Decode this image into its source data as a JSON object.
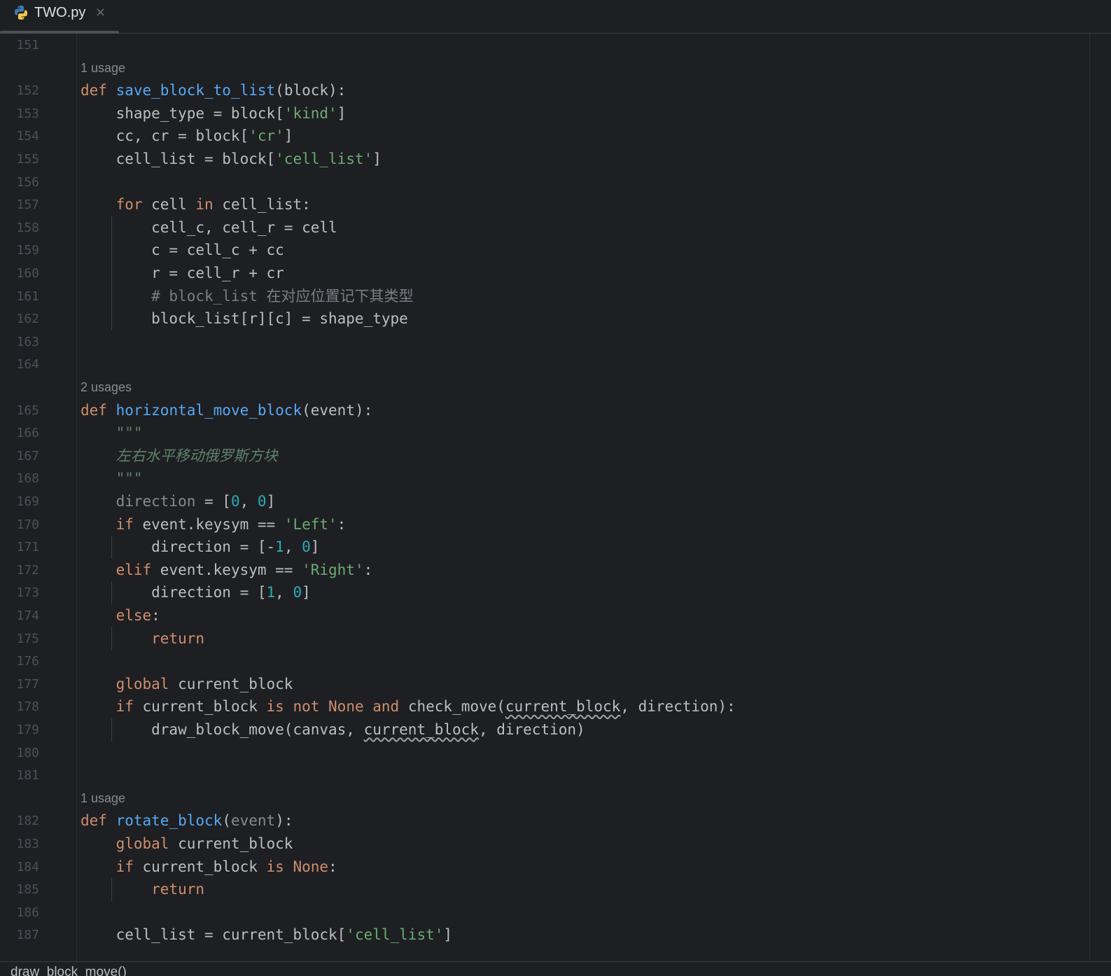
{
  "tab": {
    "file_name": "TWO.py",
    "close_glyph": "×",
    "icon": "python-file-icon"
  },
  "breadcrumb": "draw_block_move()",
  "colors": {
    "keyword": "#cf8e6d",
    "function": "#56a8f5",
    "string": "#6aab73",
    "number": "#2aacb8",
    "comment": "#7a7e85",
    "docstring": "#5f826b",
    "text": "#bcbec4"
  },
  "editor": {
    "lines": [
      {
        "num": "151",
        "tokens": []
      },
      {
        "hint": "1 usage"
      },
      {
        "num": "152",
        "tokens": [
          [
            "def",
            "kw"
          ],
          [
            " ",
            ""
          ],
          [
            "save_block_to_list",
            "fn"
          ],
          [
            "(block):",
            ""
          ]
        ]
      },
      {
        "num": "153",
        "tokens": [
          [
            "    shape_type = block[",
            ""
          ],
          [
            "'kind'",
            "str"
          ],
          [
            "]",
            ""
          ]
        ]
      },
      {
        "num": "154",
        "tokens": [
          [
            "    cc, cr = block[",
            ""
          ],
          [
            "'cr'",
            "str"
          ],
          [
            "]",
            ""
          ]
        ]
      },
      {
        "num": "155",
        "tokens": [
          [
            "    cell_list = block[",
            ""
          ],
          [
            "'cell_list'",
            "str"
          ],
          [
            "]",
            ""
          ]
        ]
      },
      {
        "num": "156",
        "tokens": []
      },
      {
        "num": "157",
        "tokens": [
          [
            "    ",
            ""
          ],
          [
            "for",
            "kw"
          ],
          [
            " cell ",
            ""
          ],
          [
            "in",
            "kw"
          ],
          [
            " cell_list:",
            ""
          ]
        ]
      },
      {
        "num": "158",
        "tokens": [
          [
            "        cell_c, cell_r = cell",
            ""
          ]
        ]
      },
      {
        "num": "159",
        "tokens": [
          [
            "        c = cell_c + cc",
            ""
          ]
        ]
      },
      {
        "num": "160",
        "tokens": [
          [
            "        r = cell_r + cr",
            ""
          ]
        ]
      },
      {
        "num": "161",
        "tokens": [
          [
            "        # block_list ",
            "cmt"
          ],
          [
            "在对应位置记下其类型",
            "cmtcjk"
          ]
        ]
      },
      {
        "num": "162",
        "tokens": [
          [
            "        block_list[r][c] = shape_type",
            ""
          ]
        ]
      },
      {
        "num": "163",
        "tokens": []
      },
      {
        "num": "164",
        "tokens": []
      },
      {
        "hint": "2 usages"
      },
      {
        "num": "165",
        "tokens": [
          [
            "def",
            "kw"
          ],
          [
            " ",
            ""
          ],
          [
            "horizontal_move_block",
            "fn"
          ],
          [
            "(event):",
            ""
          ]
        ]
      },
      {
        "num": "166",
        "tokens": [
          [
            "    \"\"\"",
            "doc"
          ]
        ]
      },
      {
        "num": "167",
        "tokens": [
          [
            "    ",
            ""
          ],
          [
            "左右水平移动俄罗斯方块",
            "docit"
          ]
        ]
      },
      {
        "num": "168",
        "tokens": [
          [
            "    \"\"\"",
            "doc"
          ]
        ]
      },
      {
        "num": "169",
        "tokens": [
          [
            "    ",
            ""
          ],
          [
            "direction",
            "dim"
          ],
          [
            " = [",
            ""
          ],
          [
            "0",
            "num"
          ],
          [
            ", ",
            ""
          ],
          [
            "0",
            "num"
          ],
          [
            "]",
            ""
          ]
        ]
      },
      {
        "num": "170",
        "tokens": [
          [
            "    ",
            ""
          ],
          [
            "if",
            "kw"
          ],
          [
            " event.keysym == ",
            ""
          ],
          [
            "'Left'",
            "str"
          ],
          [
            ":",
            ""
          ]
        ]
      },
      {
        "num": "171",
        "tokens": [
          [
            "        direction = [-",
            ""
          ],
          [
            "1",
            "num"
          ],
          [
            ", ",
            ""
          ],
          [
            "0",
            "num"
          ],
          [
            "]",
            ""
          ]
        ]
      },
      {
        "num": "172",
        "tokens": [
          [
            "    ",
            ""
          ],
          [
            "elif",
            "kw"
          ],
          [
            " event.keysym == ",
            ""
          ],
          [
            "'Right'",
            "str"
          ],
          [
            ":",
            ""
          ]
        ]
      },
      {
        "num": "173",
        "tokens": [
          [
            "        direction = [",
            ""
          ],
          [
            "1",
            "num"
          ],
          [
            ", ",
            ""
          ],
          [
            "0",
            "num"
          ],
          [
            "]",
            ""
          ]
        ]
      },
      {
        "num": "174",
        "tokens": [
          [
            "    ",
            ""
          ],
          [
            "else",
            "kw"
          ],
          [
            ":",
            ""
          ]
        ]
      },
      {
        "num": "175",
        "tokens": [
          [
            "        ",
            ""
          ],
          [
            "return",
            "kw"
          ]
        ]
      },
      {
        "num": "176",
        "tokens": []
      },
      {
        "num": "177",
        "tokens": [
          [
            "    ",
            ""
          ],
          [
            "global",
            "kw"
          ],
          [
            " current_block",
            ""
          ]
        ]
      },
      {
        "num": "178",
        "tokens": [
          [
            "    ",
            ""
          ],
          [
            "if",
            "kw"
          ],
          [
            " current_block ",
            ""
          ],
          [
            "is not None and",
            "kw"
          ],
          [
            " check_move(",
            ""
          ],
          [
            "current_block",
            "warn"
          ],
          [
            ", direction):",
            ""
          ]
        ]
      },
      {
        "num": "179",
        "tokens": [
          [
            "        draw_block_move(canvas, ",
            ""
          ],
          [
            "current_block",
            "warn"
          ],
          [
            ", direction)",
            ""
          ]
        ]
      },
      {
        "num": "180",
        "tokens": []
      },
      {
        "num": "181",
        "tokens": []
      },
      {
        "hint": "1 usage"
      },
      {
        "num": "182",
        "tokens": [
          [
            "def",
            "kw"
          ],
          [
            " ",
            ""
          ],
          [
            "rotate_block",
            "fn"
          ],
          [
            "(",
            ""
          ],
          [
            "event",
            "dim"
          ],
          [
            "):",
            ""
          ]
        ]
      },
      {
        "num": "183",
        "tokens": [
          [
            "    ",
            ""
          ],
          [
            "global",
            "kw"
          ],
          [
            " current_block",
            ""
          ]
        ]
      },
      {
        "num": "184",
        "tokens": [
          [
            "    ",
            ""
          ],
          [
            "if",
            "kw"
          ],
          [
            " current_block ",
            ""
          ],
          [
            "is None",
            "kw"
          ],
          [
            ":",
            ""
          ]
        ]
      },
      {
        "num": "185",
        "tokens": [
          [
            "        ",
            ""
          ],
          [
            "return",
            "kw"
          ]
        ]
      },
      {
        "num": "186",
        "tokens": []
      },
      {
        "num": "187",
        "tokens": [
          [
            "    cell_list = current_block[",
            ""
          ],
          [
            "'cell_list'",
            "str"
          ],
          [
            "]",
            ""
          ]
        ]
      }
    ]
  }
}
